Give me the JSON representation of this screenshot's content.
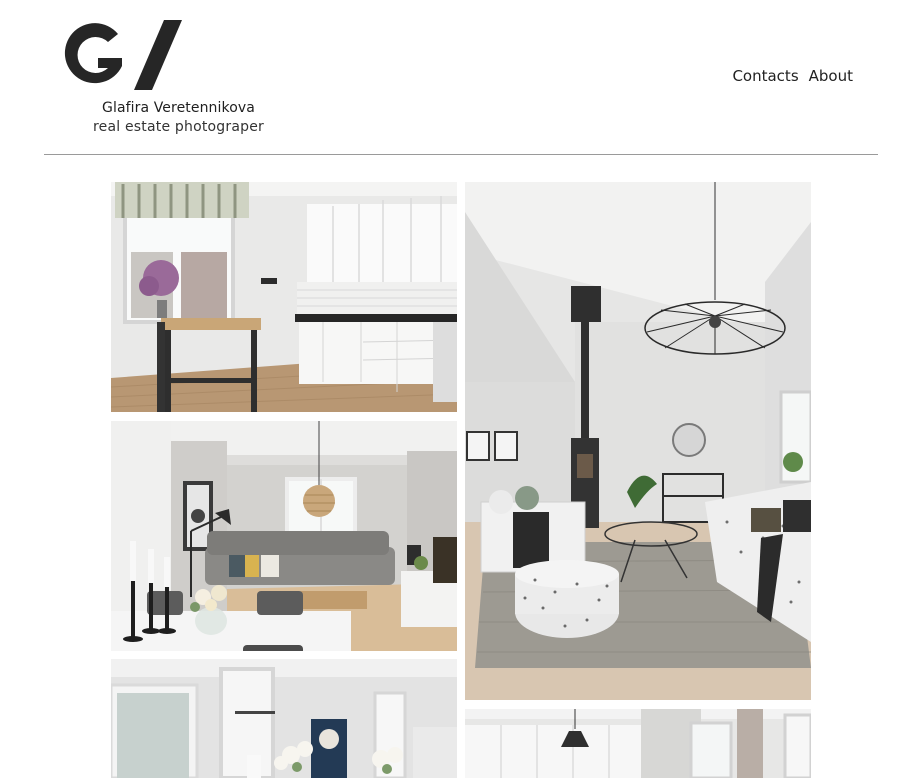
{
  "header": {
    "brand_name": "Glafira Veretennikova",
    "brand_subtitle": "real estate photograper",
    "logo_letters": "G/",
    "nav": [
      {
        "label": "Contacts"
      },
      {
        "label": "About"
      }
    ]
  },
  "gallery": {
    "photos": [
      {
        "subject": "white kitchen with dining table and window"
      },
      {
        "subject": "bright living room with fireplace and pendant lamp"
      },
      {
        "subject": "living and dining room with rattan pendant lamp"
      },
      {
        "subject": "white interior with flowers and artwork"
      },
      {
        "subject": "room with white wardrobes and black pendant lamp"
      }
    ]
  },
  "colors": {
    "text": "#222222",
    "divider": "#9a9a9a",
    "logo": "#262626"
  }
}
